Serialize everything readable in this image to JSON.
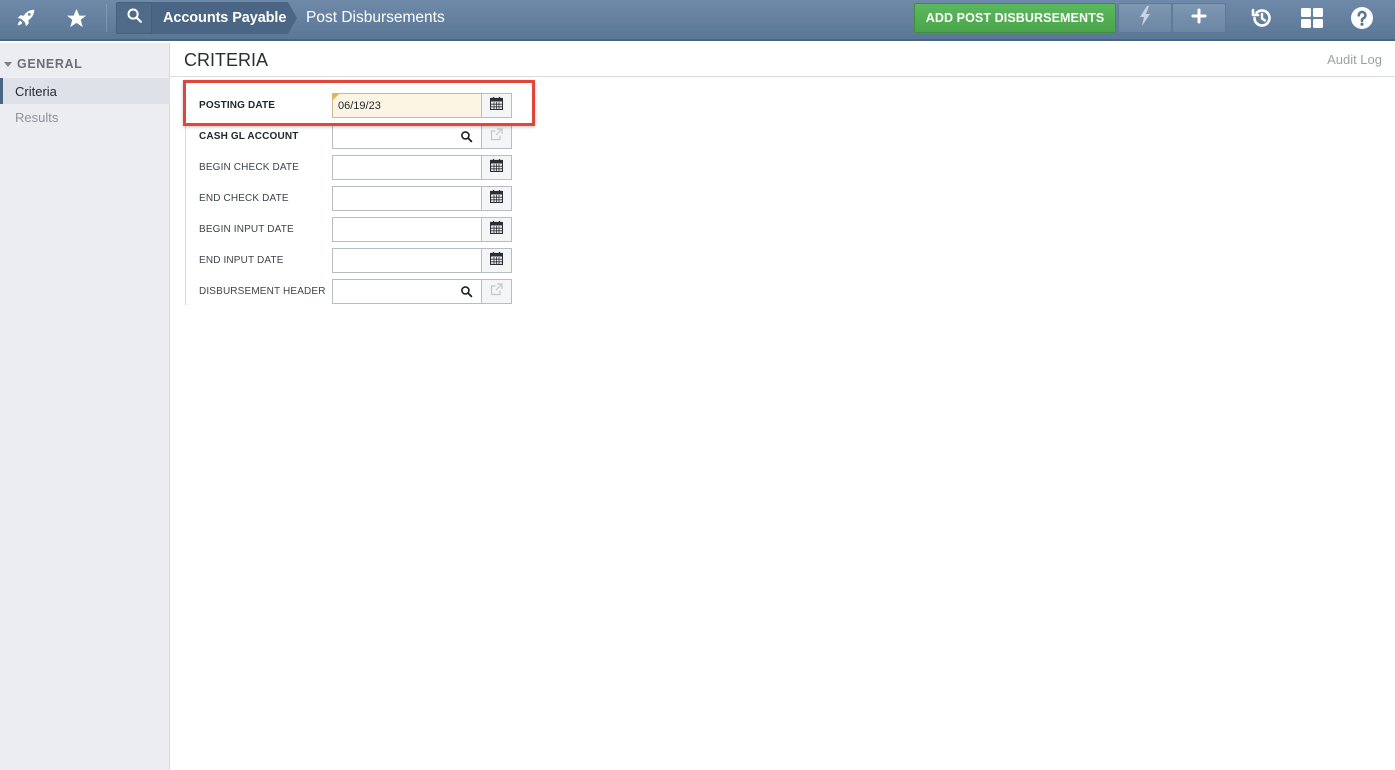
{
  "header": {
    "module": "Accounts Payable",
    "page": "Post Disbursements",
    "add_button": "ADD POST DISBURSEMENTS",
    "icons": [
      "rocket-icon",
      "star-icon",
      "search-icon",
      "bolt-icon",
      "plus-icon",
      "history-icon",
      "grid-icon",
      "help-icon"
    ],
    "accent_color": "#5b7796",
    "add_button_color": "#4aa54a"
  },
  "sidebar": {
    "section": "GENERAL",
    "items": [
      {
        "label": "Criteria",
        "active": true
      },
      {
        "label": "Results",
        "active": false
      }
    ]
  },
  "main": {
    "title": "CRITERIA",
    "audit_log": "Audit Log",
    "fields": [
      {
        "label": "POSTING DATE",
        "value": "06/19/23",
        "type": "date",
        "required": true
      },
      {
        "label": "CASH GL ACCOUNT",
        "value": "",
        "type": "lookup",
        "required": true
      },
      {
        "label": "BEGIN CHECK DATE",
        "value": "",
        "type": "date",
        "required": false
      },
      {
        "label": "END CHECK DATE",
        "value": "",
        "type": "date",
        "required": false
      },
      {
        "label": "BEGIN INPUT DATE",
        "value": "",
        "type": "date",
        "required": false
      },
      {
        "label": "END INPUT DATE",
        "value": "",
        "type": "date",
        "required": false
      },
      {
        "label": "DISBURSEMENT HEADER",
        "value": "",
        "type": "lookup",
        "required": false
      }
    ],
    "highlight_color": "#e0473a"
  }
}
